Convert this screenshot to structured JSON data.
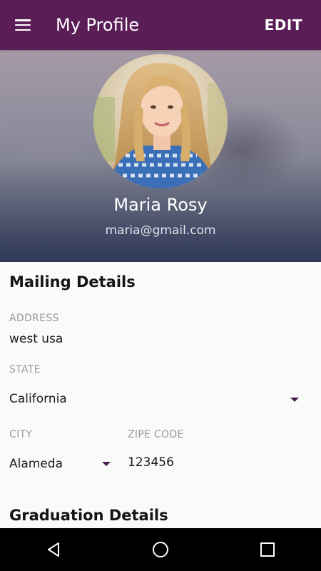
{
  "appbar": {
    "title": "My Profile",
    "edit_label": "EDIT",
    "menu_icon": "hamburger-menu-icon",
    "background": "#5a1d56"
  },
  "profile": {
    "name": "Maria Rosy",
    "email": "maria@gmail.com"
  },
  "mailing": {
    "section_title": "Mailing Details",
    "address_label": "ADDRESS",
    "address_value": "west usa",
    "state_label": "STATE",
    "state_value": "California",
    "city_label": "CITY",
    "city_value": "Alameda",
    "zip_label": "ZIPE CODE",
    "zip_value": "123456"
  },
  "graduation": {
    "section_title": "Graduation Details"
  },
  "navbar": {
    "back_icon": "back-triangle-icon",
    "home_icon": "home-circle-icon",
    "recents_icon": "recents-square-icon"
  },
  "colors": {
    "accent": "#4b1d52",
    "hint_text": "#9a9a9a"
  }
}
